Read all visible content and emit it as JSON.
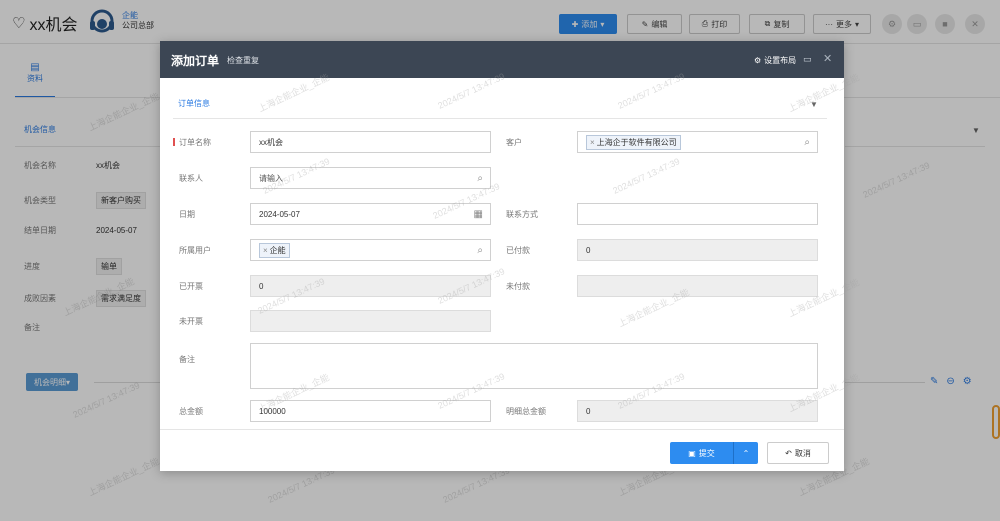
{
  "page": {
    "title": "xx机会",
    "owner_name": "企能",
    "owner_dept": "公司总部"
  },
  "toolbar": {
    "add": "添加",
    "edit": "编辑",
    "print": "打印",
    "copy": "复制",
    "more": "更多"
  },
  "tabs": {
    "info": "资料"
  },
  "opportunity": {
    "section_title": "机会信息",
    "rows": [
      {
        "label": "机会名称",
        "value": "xx机会"
      },
      {
        "label": "机会类型",
        "value": "新客户购买"
      },
      {
        "label": "结单日期",
        "value": "2024-05-07"
      },
      {
        "label": "进度",
        "value": "输单"
      },
      {
        "label": "成败因素",
        "value": "需求满足度"
      },
      {
        "label": "备注",
        "value": ""
      }
    ],
    "detail_button": "机会明细"
  },
  "modal": {
    "title": "添加订单",
    "check_duplicate": "检查重复",
    "layout_settings": "设置布局",
    "section_title": "订单信息",
    "fields": {
      "order_name": {
        "label": "订单名称",
        "value": "xx机会"
      },
      "customer": {
        "label": "客户",
        "chip": "上海企于软件有限公司"
      },
      "contact": {
        "label": "联系人",
        "placeholder": "请输入"
      },
      "date": {
        "label": "日期",
        "value": "2024-05-07"
      },
      "contact_method": {
        "label": "联系方式",
        "value": ""
      },
      "owner_user": {
        "label": "所属用户",
        "chip": "企能"
      },
      "paid": {
        "label": "已付款",
        "value": "0"
      },
      "invoiced": {
        "label": "已开票",
        "value": "0"
      },
      "unpaid": {
        "label": "未付款",
        "value": ""
      },
      "uninvoiced": {
        "label": "未开票",
        "value": ""
      },
      "remark": {
        "label": "备注",
        "value": ""
      },
      "total": {
        "label": "总金额",
        "value": "100000"
      },
      "detail_total": {
        "label": "明细总金额",
        "value": "0"
      }
    },
    "submit": "提交",
    "cancel": "取消"
  },
  "watermark": {
    "company": "上海企能企业_企能",
    "timestamp": "2024/5/7 13:47:39"
  }
}
